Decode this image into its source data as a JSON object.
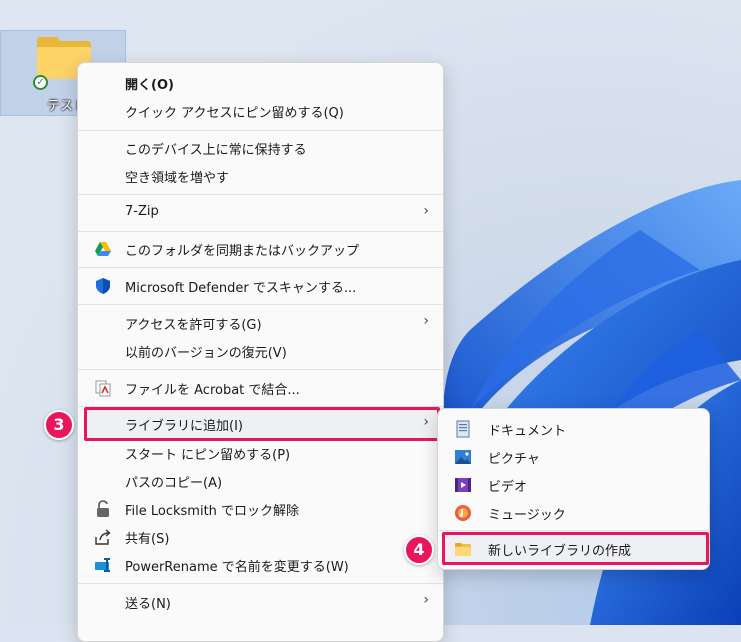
{
  "desktop": {
    "icon_label": "テスト"
  },
  "context_menu": {
    "items": [
      {
        "label": "開く(O)"
      },
      {
        "label": "クイック アクセスにピン留めする(Q)"
      },
      {
        "label": "このデバイス上に常に保持する"
      },
      {
        "label": "空き領域を増やす"
      },
      {
        "label": "7-Zip"
      },
      {
        "label": "このフォルダを同期またはバックアップ"
      },
      {
        "label": "Microsoft Defender でスキャンする..."
      },
      {
        "label": "アクセスを許可する(G)"
      },
      {
        "label": "以前のバージョンの復元(V)"
      },
      {
        "label": "ファイルを Acrobat で結合..."
      },
      {
        "label": "ライブラリに追加(I)"
      },
      {
        "label": "スタート にピン留めする(P)"
      },
      {
        "label": "パスのコピー(A)"
      },
      {
        "label": "File Locksmith でロック解除"
      },
      {
        "label": "共有(S)"
      },
      {
        "label": "PowerRename で名前を変更する(W)"
      },
      {
        "label": "送る(N)"
      }
    ],
    "chevron": "›"
  },
  "submenu": {
    "items": [
      {
        "label": "ドキュメント"
      },
      {
        "label": "ピクチャ"
      },
      {
        "label": "ビデオ"
      },
      {
        "label": "ミュージック"
      },
      {
        "label": "新しいライブラリの作成"
      }
    ]
  },
  "annotations": {
    "step3": "3",
    "step4": "4",
    "highlight_color": "#e8175d"
  },
  "icons": [
    "folder-icon",
    "sync-check-icon",
    "google-drive-icon",
    "defender-shield-icon",
    "acrobat-icon",
    "lock-icon",
    "share-icon",
    "powerrename-icon",
    "documents-icon",
    "pictures-icon",
    "videos-icon",
    "music-icon",
    "new-library-icon"
  ]
}
